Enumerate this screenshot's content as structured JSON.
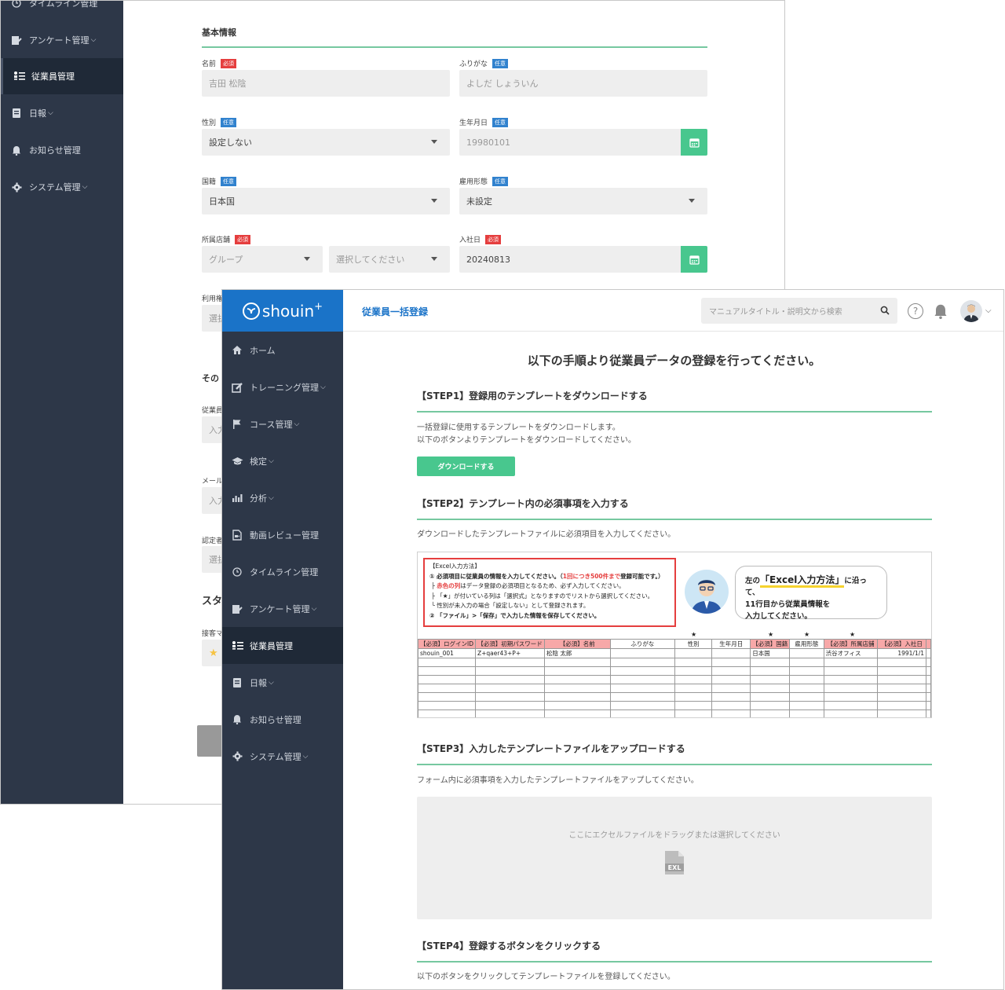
{
  "back": {
    "sidebar": [
      {
        "label": "タイムライン管理",
        "caret": false
      },
      {
        "label": "アンケート管理",
        "caret": true
      },
      {
        "label": "従業員管理",
        "caret": false
      },
      {
        "label": "日報",
        "caret": true
      },
      {
        "label": "お知らせ管理",
        "caret": false
      },
      {
        "label": "システム管理",
        "caret": true
      }
    ],
    "section_basic": "基本情報",
    "section_other": "その",
    "section_staff": "スタ",
    "badges": {
      "required": "必須",
      "optional": "任意"
    },
    "fields": {
      "name": {
        "label": "名前",
        "value": "吉田 松陰"
      },
      "kana": {
        "label": "ふりがな",
        "value": "よしだ しょういん"
      },
      "gender": {
        "label": "性別",
        "value": "設定しない"
      },
      "birthday": {
        "label": "生年月日",
        "value": "19980101"
      },
      "nationality": {
        "label": "国籍",
        "value": "日本国"
      },
      "employment": {
        "label": "雇用形態",
        "value": "未設定"
      },
      "store": {
        "label": "所属店舗",
        "group_placeholder": "グループ",
        "select_placeholder": "選択してください"
      },
      "join_date": {
        "label": "入社日",
        "value": "20240813"
      },
      "usage": {
        "label": "利用権",
        "value": "選択"
      },
      "employee_id": {
        "label": "従業員",
        "value": "入力"
      },
      "mail": {
        "label": "メール",
        "value": "入力"
      },
      "cert": {
        "label": "認定者",
        "value": "選択"
      },
      "hospitality": {
        "label": "接客マ"
      }
    }
  },
  "front": {
    "brand": {
      "name": "shouin",
      "plus": "+"
    },
    "topbar": {
      "title": "従業員一括登録",
      "search_placeholder": "マニュアルタイトル・説明文から検索",
      "help": "?"
    },
    "sidebar": [
      {
        "label": "ホーム",
        "caret": false,
        "icon": "home-icon"
      },
      {
        "label": "トレーニング管理",
        "caret": true,
        "icon": "edit-icon"
      },
      {
        "label": "コース管理",
        "caret": true,
        "icon": "flag-icon"
      },
      {
        "label": "検定",
        "caret": true,
        "icon": "graduation-cap-icon"
      },
      {
        "label": "分析",
        "caret": true,
        "icon": "bar-chart-icon"
      },
      {
        "label": "動画レビュー管理",
        "caret": false,
        "icon": "video-file-icon"
      },
      {
        "label": "タイムライン管理",
        "caret": false,
        "icon": "clock-icon"
      },
      {
        "label": "アンケート管理",
        "caret": true,
        "icon": "survey-icon"
      },
      {
        "label": "従業員管理",
        "caret": false,
        "icon": "employee-list-icon",
        "active": true
      },
      {
        "label": "日報",
        "caret": true,
        "icon": "report-icon"
      },
      {
        "label": "お知らせ管理",
        "caret": false,
        "icon": "bell-icon"
      },
      {
        "label": "システム管理",
        "caret": true,
        "icon": "gear-icon"
      }
    ],
    "main_title": "以下の手順より従業員データの登録を行ってください。",
    "steps": [
      {
        "title": "【STEP1】登録用のテンプレートをダウンロードする",
        "text1": "一括登録に使用するテンプレートをダウンロードします。",
        "text2": "以下のボタンよりテンプレートをダウンロードしてください。"
      },
      {
        "title": "【STEP2】テンプレート内の必須事項を入力する",
        "text1": "ダウンロードしたテンプレートファイルに必須項目を入力してください。"
      },
      {
        "title": "【STEP3】入力したテンプレートファイルをアップロードする",
        "text1": "フォーム内に必須事項を入力したテンプレートファイルをアップしてください。"
      },
      {
        "title": "【STEP4】登録するボタンをクリックする",
        "text1": "以下のボタンをクリックしてテンプレートファイルを登録してください。"
      }
    ],
    "download_button": "ダウンロードする",
    "excel": {
      "instructions": {
        "heading": "【Excel入力方法】",
        "line1_a": "① 必須項目に従業員の情報を入力してください。（",
        "line1_red": "1回につき500件まで",
        "line1_b": "登録可能です。）",
        "line2_red": "赤色の列",
        "line2": "はデータ登録の必須項目となるため、必ず入力してください。",
        "line3": "「★」が付いている列は「選択式」となりますのでリストから選択してください。",
        "line4": "性別が未入力の場合「設定しない」として登録されます。",
        "line5": "② 「ファイル」>「保存」で入力した情報を保存してください。"
      },
      "bubble": {
        "a": "左の",
        "big": "「Excel入力方法」",
        "b": "に沿って、",
        "line2": "11行目から従業員情報を",
        "line3": "入力してください。"
      },
      "star": "★",
      "headers": [
        "【必須】ログインID",
        "【必須】初期パスワード",
        "【必須】名前",
        "ふりがな",
        "性別",
        "生年月日",
        "【必須】国籍",
        "雇用形態",
        "【必須】所属店舗",
        "【必須】入社日"
      ],
      "row": [
        "shouin_001",
        "Z+qaer43+P+",
        "松陰 太郎",
        "",
        "",
        "",
        "日本国",
        "",
        "渋谷オフィス",
        "1991/1/1"
      ]
    },
    "dropzone": {
      "text": "ここにエクセルファイルをドラッグまたは選択してください",
      "icon_label": "EXL"
    }
  }
}
